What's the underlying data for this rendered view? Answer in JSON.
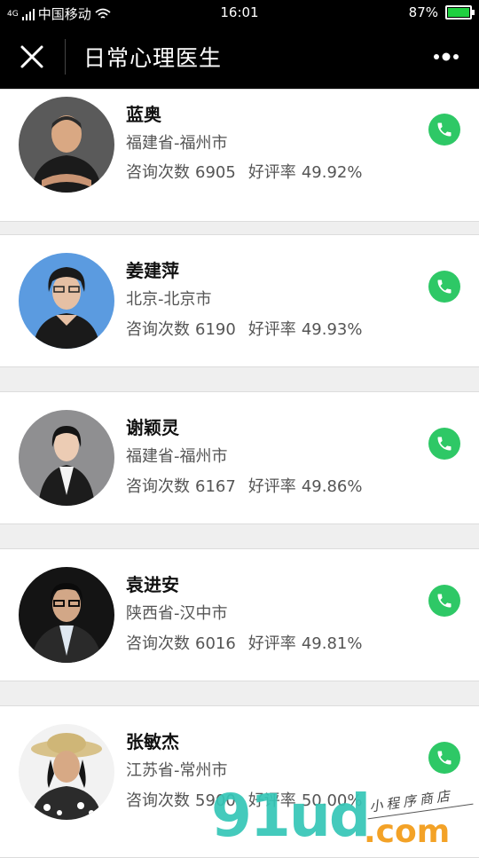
{
  "status_bar": {
    "signal": "4G",
    "carrier": "中国移动",
    "time": "16:01",
    "battery": "87%"
  },
  "header": {
    "title": "日常心理医生"
  },
  "doctors": [
    {
      "name": "蓝奥",
      "location": "福建省-福州市",
      "consult_label": "咨询次数",
      "consult_count": "6905",
      "rating_label": "好评率",
      "rating": "49.92%"
    },
    {
      "name": "姜建萍",
      "location": "北京-北京市",
      "consult_label": "咨询次数",
      "consult_count": "6190",
      "rating_label": "好评率",
      "rating": "49.93%"
    },
    {
      "name": "谢颖灵",
      "location": "福建省-福州市",
      "consult_label": "咨询次数",
      "consult_count": "6167",
      "rating_label": "好评率",
      "rating": "49.86%"
    },
    {
      "name": "袁进安",
      "location": "陕西省-汉中市",
      "consult_label": "咨询次数",
      "consult_count": "6016",
      "rating_label": "好评率",
      "rating": "49.81%"
    },
    {
      "name": "张敏杰",
      "location": "江苏省-常州市",
      "consult_label": "咨询次数",
      "consult_count": "5900",
      "rating_label": "好评率",
      "rating": "50.00%"
    }
  ],
  "watermark": {
    "main": "91ud",
    "suffix": ".com",
    "tagline": "小程序商店"
  },
  "colors": {
    "call_button": "#2ec866",
    "header_bg": "#000000"
  }
}
